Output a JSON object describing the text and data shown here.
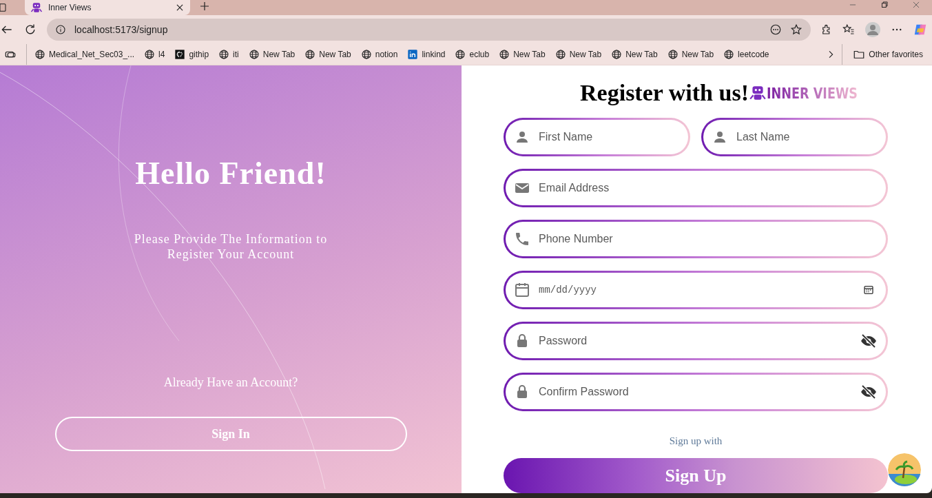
{
  "browser": {
    "tab": {
      "title": "Inner Views"
    },
    "address": "localhost:5173/signup",
    "bookmarks": [
      {
        "kind": "site",
        "label": "Medical_Net_Sec03_..."
      },
      {
        "kind": "site",
        "label": "l4"
      },
      {
        "kind": "github",
        "label": "githip"
      },
      {
        "kind": "site",
        "label": "iti"
      },
      {
        "kind": "site",
        "label": "New Tab"
      },
      {
        "kind": "site",
        "label": "New Tab"
      },
      {
        "kind": "site",
        "label": "notion"
      },
      {
        "kind": "linkedin",
        "label": "linkind"
      },
      {
        "kind": "site",
        "label": "eclub"
      },
      {
        "kind": "site",
        "label": "New Tab"
      },
      {
        "kind": "site",
        "label": "New Tab"
      },
      {
        "kind": "site",
        "label": "New Tab"
      },
      {
        "kind": "site",
        "label": "New Tab"
      },
      {
        "kind": "site",
        "label": "leetcode"
      }
    ],
    "other_favorites": "Other favorites"
  },
  "welcome": {
    "heading": "Hello Friend!",
    "message": "Please Provide The Information to Register Your Account",
    "prompt": "Already Have an Account?",
    "sign_in": "Sign In"
  },
  "form": {
    "title": "Register with us!",
    "logo_text": "INNER VIEWS",
    "fields": [
      {
        "kind": "name",
        "placeholder": "First Name"
      },
      {
        "kind": "name",
        "placeholder": "Last Name"
      },
      {
        "kind": "email",
        "placeholder": "Email Address"
      },
      {
        "kind": "phone",
        "placeholder": "Phone Number"
      },
      {
        "kind": "date",
        "placeholder": "mm/dd/yyyy"
      },
      {
        "kind": "password",
        "placeholder": "Password"
      },
      {
        "kind": "password",
        "placeholder": "Confirm Password"
      }
    ],
    "alt_text": "Sign up with",
    "submit": "Sign Up"
  }
}
